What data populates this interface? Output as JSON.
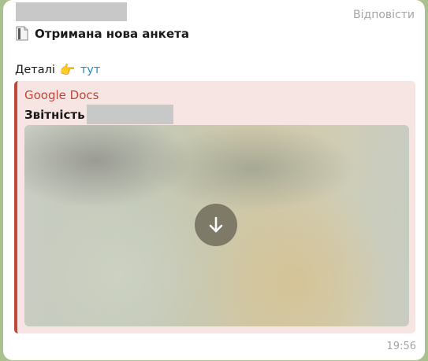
{
  "message": {
    "reply_label": "Відповісти",
    "title": "Отримана нова анкета",
    "details_text": "Деталі",
    "details_link": "тут",
    "time": "19:56"
  },
  "link_preview": {
    "site_name": "Google Docs",
    "title": "Звітність"
  },
  "icons": {
    "title_icon": "document-icon",
    "pointer": "pointing-hand-icon",
    "download": "download-arrow-icon"
  },
  "colors": {
    "preview_accent": "#c0473a",
    "preview_background": "#f7e5e4",
    "link": "#2a8bc9",
    "chat_background": "#a9c08f"
  }
}
